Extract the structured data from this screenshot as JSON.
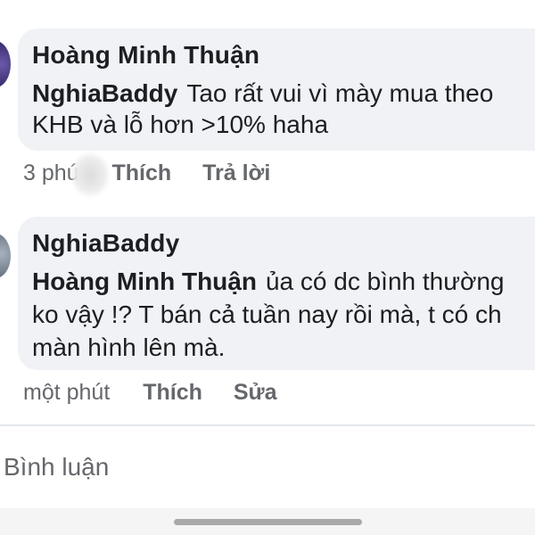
{
  "comments": [
    {
      "author": "Hoàng Minh Thuận",
      "mention": "NghiaBaddy",
      "line1": "Tao rất vui vì mày mua theo",
      "line2": "KHB và lỗ hơn >10% haha",
      "time": "3 phú",
      "like_label": "Thích",
      "second_action_label": "Trả lời"
    },
    {
      "author": "NghiaBaddy",
      "mention": "Hoàng Minh Thuận",
      "line1": "ủa có dc bình thường",
      "line2": "ko vậy !? T bán cả tuần nay rồi mà, t có ch",
      "line3": "màn hình lên mà.",
      "time": "một phút",
      "like_label": "Thích",
      "second_action_label": "Sửa"
    }
  ],
  "composer": {
    "placeholder": "Bình luận"
  },
  "colors": {
    "bubble": "#f0f2f5",
    "secondary_text": "#65676b",
    "primary_text": "#1c1e21"
  }
}
